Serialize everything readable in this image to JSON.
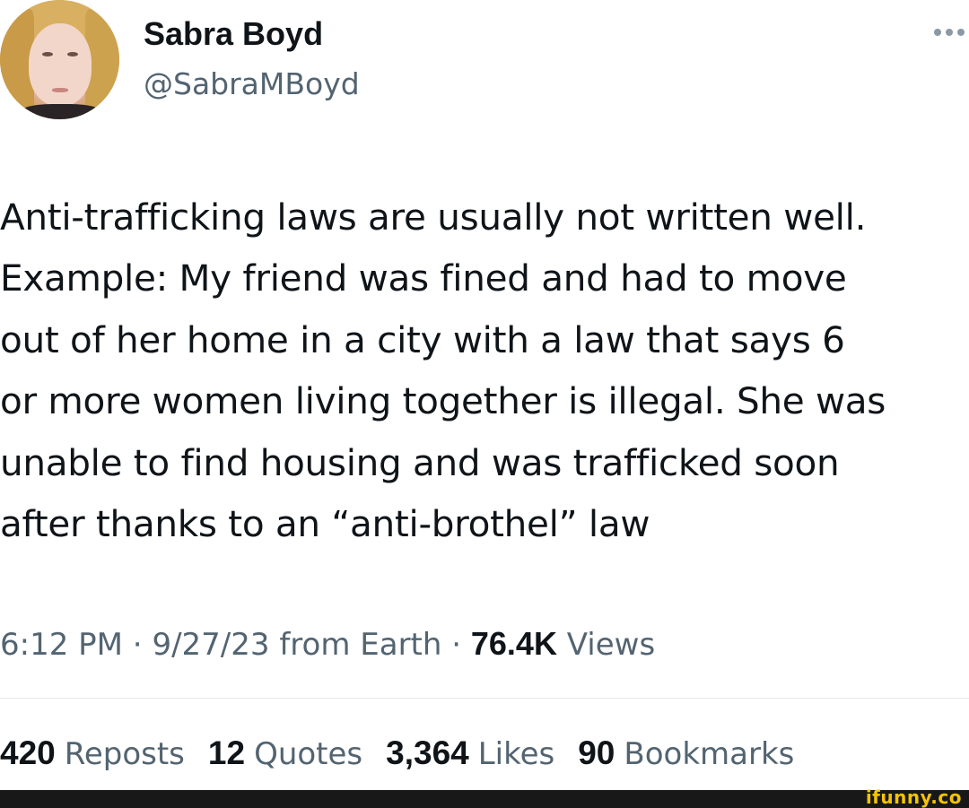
{
  "tweet": {
    "author": {
      "name": "Sabra Boyd",
      "handle": "@SabraMBoyd",
      "avatar_icon": "profile-photo"
    },
    "more_icon": "ellipsis-icon",
    "text": "Anti-trafficking laws are usually not written well.\nExample: My friend was fined and had to move\nout of her home in a city with a law that says 6\nor more women living together is illegal. She was\nunable to find housing and was trafficked soon\nafter thanks to an “anti-brothel” law",
    "meta": {
      "time": "6:12 PM",
      "separator": " · ",
      "date": "9/27/23",
      "source": " from Earth",
      "views_count": "76.4K",
      "views_label": " Views"
    },
    "stats": [
      {
        "count": "420",
        "label": "Reposts"
      },
      {
        "count": "12",
        "label": "Quotes"
      },
      {
        "count": "3,364",
        "label": "Likes"
      },
      {
        "count": "90",
        "label": "Bookmarks"
      }
    ]
  },
  "watermark": "ifunny.co",
  "colors": {
    "text_primary": "#0f1419",
    "text_secondary": "#536471",
    "divider": "#e4e7ea",
    "watermark": "#f5c400",
    "footer_bar": "#181818"
  }
}
